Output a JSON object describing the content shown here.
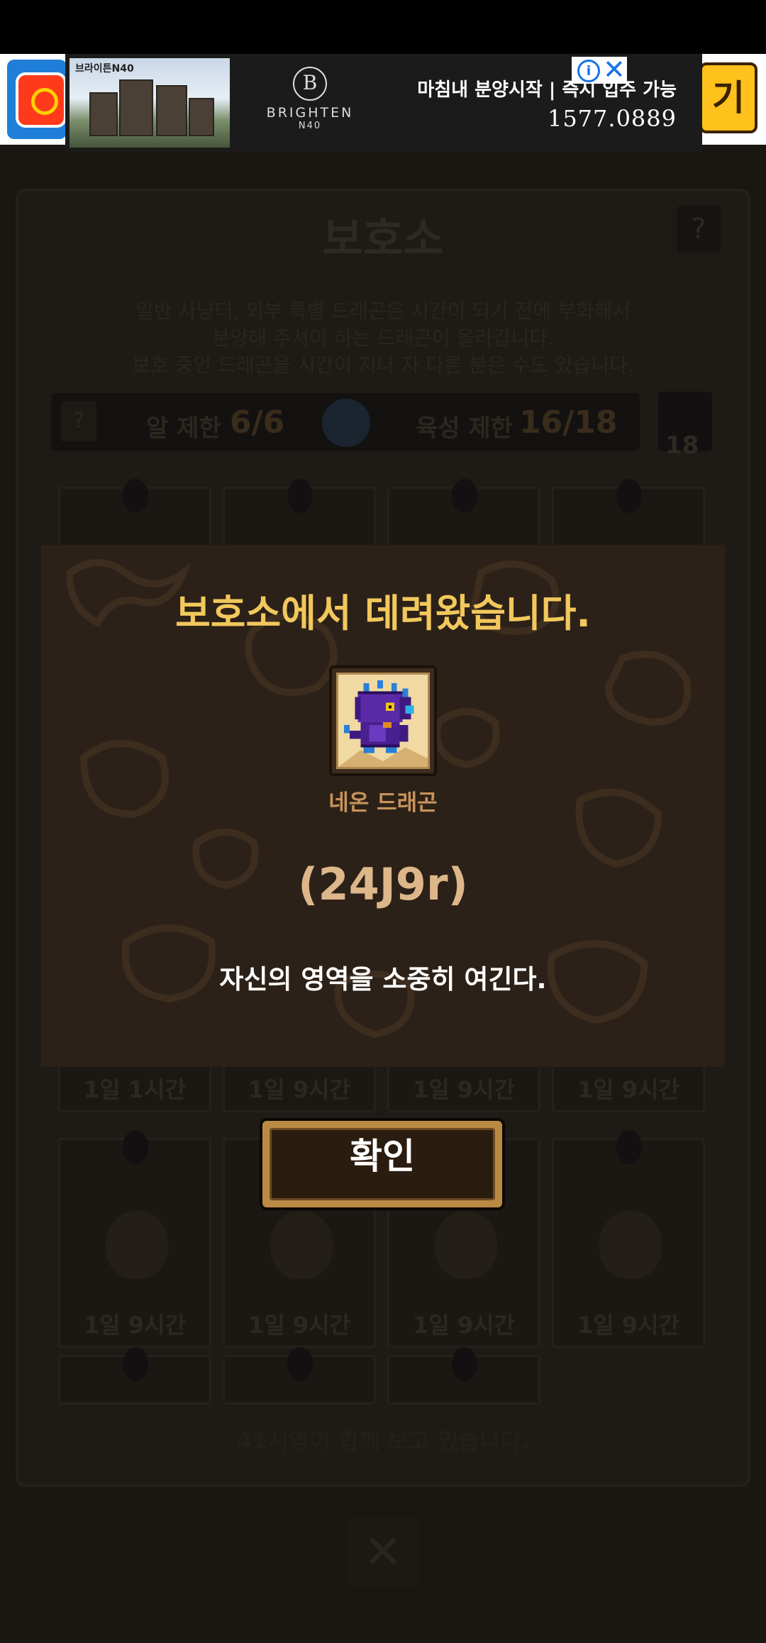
{
  "ad": {
    "photo_label": "브라이튼N40",
    "logo_mark": "B",
    "brand": "BRIGHTEN",
    "brand_sub": "N40",
    "headline": "마침내 분양시작 | 즉시 입주 가능",
    "phone": "1577.0889",
    "right_app_text": "기"
  },
  "background": {
    "title": "보호소",
    "help": "?",
    "description": [
      "일반 사냥터, 외부 특별 드래곤은 시간이 되기 전에 부화해서",
      "분양해 주셔야 하는 드래곤이 올라갑니다.",
      "보호 중인 드래곤을 시간이 지나 자 다른 분은 수도 있습니다."
    ],
    "egg_limit_label": "알 제한",
    "egg_limit_value": "6/6",
    "raise_limit_label": "육성 제한",
    "raise_limit_value": "16/18",
    "refresh_count": "18",
    "slot_timers_row2": [
      "1일 1시간",
      "1일 9시간",
      "1일 9시간",
      "1일 9시간"
    ],
    "slot_timers_row3": [
      "1일 9시간",
      "1일 9시간",
      "1일 9시간",
      "1일 9시간"
    ],
    "footer": "41시명이 함께 보고 있습니다.",
    "close": "✕"
  },
  "modal": {
    "title": "보호소에서 데려왔습니다.",
    "dragon_name": "네온 드래곤",
    "dragon_code": "(24J9r)",
    "description": "자신의 영역을 소중히 여긴다."
  },
  "confirm_label": "확인",
  "colors": {
    "title_gold": "#f2c85c",
    "name_tan": "#c7935a",
    "modal_bg": "#2c2118"
  }
}
